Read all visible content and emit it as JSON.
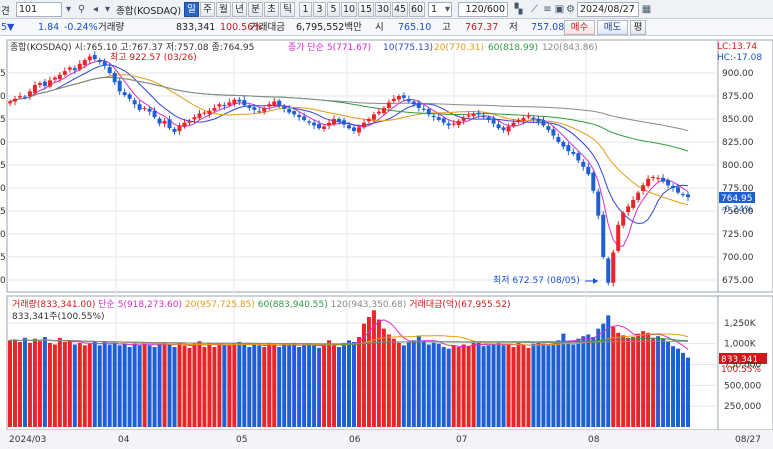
{
  "toolbar": {
    "left_label": "견",
    "code_value": "101",
    "name_value": "종합(KOSDAQ)",
    "periods": [
      "일",
      "주",
      "월",
      "년",
      "분",
      "초",
      "틱"
    ],
    "active_period": "일",
    "intervals": [
      "1",
      "3",
      "5",
      "10",
      "15",
      "30",
      "45",
      "60"
    ],
    "interval_select": "1",
    "count_display": "120/600",
    "date_value": "2024/08/27"
  },
  "quote": {
    "arrow": "5▼",
    "change": "1.84",
    "change_pct": "-0.24%",
    "volume_label": "거래량",
    "volume": "833,341",
    "volume_ratio": "100.56%",
    "amount_label": "거래대금",
    "amount": "6,795,552백만",
    "open_label": "시",
    "open": "765.10",
    "high_label": "고",
    "high": "767.37",
    "low_label": "저",
    "low": "757.08",
    "buy_label": "매수",
    "sell_label": "매도",
    "eval_label": "평"
  },
  "price_panel": {
    "legend_main": "종합(KOSDAQ) 시:765.10 고:767.37 저:757.08 종:764.95",
    "ma_label": "종가 단순",
    "ma5": "5(771.67)",
    "ma10": "10(775.13)",
    "ma20": "20(770.31)",
    "ma60": "60(818.99)",
    "ma120": "120(843.86)",
    "lc": "LC:13.74",
    "hc": "HC:-17.08",
    "max_note": "최고 922.57 (03/26)",
    "min_note": "최저 672.57 (08/05)",
    "current_price": "764.95",
    "current_pct": "-0.24%",
    "yticks": [
      "900.00",
      "875.00",
      "850.00",
      "825.00",
      "800.00",
      "775.00",
      "750.00",
      "725.00",
      "700.00",
      "675.00"
    ],
    "left_edge_ticks": [
      "5",
      "0",
      "5",
      "0",
      "5",
      "0",
      "5",
      "0",
      "5",
      "0"
    ]
  },
  "volume_panel": {
    "legend_vol": "거래량(833,341.00)",
    "ma_label": "단순",
    "ma5": "5(918,273.60)",
    "ma20": "20(957,725.85)",
    "ma60": "60(883,940.55)",
    "ma120": "120(943,350.68)",
    "legend_amt": "거래대금(억)(67,955.52)",
    "note": "833,341주(100.55%)",
    "current_vol": "833,341",
    "current_pct": "100.55%",
    "yticks": [
      "1,250K",
      "1,000K",
      "750,000",
      "500,000",
      "250,000"
    ]
  },
  "xaxis": {
    "labels": [
      "2024/03",
      "04",
      "05",
      "06",
      "07",
      "08"
    ],
    "right_label": "08/27"
  },
  "colors": {
    "up": "#e8262a",
    "down": "#1f5fd6",
    "ma5": "#d82bd0",
    "ma10": "#3246d8",
    "ma20": "#e89a18",
    "ma60": "#2e9c42",
    "ma120": "#8a8a8a"
  },
  "chart_data": {
    "type": "candlestick",
    "close_start": 869,
    "close_series": [
      869,
      872,
      875,
      874,
      880,
      887,
      889,
      886,
      892,
      895,
      898,
      902,
      906,
      903,
      910,
      914,
      918,
      915,
      912,
      908,
      900,
      890,
      880,
      876,
      872,
      866,
      860,
      862,
      858,
      852,
      845,
      848,
      840,
      836,
      843,
      846,
      848,
      852,
      856,
      857,
      859,
      862,
      866,
      864,
      868,
      871,
      869,
      865,
      862,
      860,
      858,
      862,
      866,
      869,
      865,
      861,
      857,
      855,
      852,
      849,
      846,
      843,
      840,
      842,
      846,
      850,
      847,
      844,
      840,
      837,
      841,
      846,
      850,
      855,
      858,
      862,
      868,
      872,
      875,
      873,
      869,
      866,
      862,
      860,
      855,
      852,
      849,
      846,
      843,
      845,
      848,
      851,
      854,
      856,
      855,
      852,
      849,
      845,
      840,
      838,
      842,
      846,
      849,
      851,
      853,
      850,
      847,
      843,
      838,
      832,
      825,
      820,
      815,
      812,
      805,
      798,
      790,
      772,
      745,
      700,
      672,
      705,
      735,
      748,
      755,
      762,
      770,
      778,
      785,
      787,
      786,
      782,
      778,
      775,
      770,
      768,
      765
    ],
    "volume_series": [
      1040,
      1050,
      1020,
      1070,
      1010,
      1060,
      1030,
      1080,
      1010,
      990,
      1070,
      1020,
      1040,
      990,
      1010,
      980,
      1000,
      1030,
      980,
      1020,
      990,
      1010,
      980,
      1000,
      960,
      1000,
      980,
      1010,
      980,
      960,
      1000,
      1020,
      990,
      960,
      1010,
      980,
      950,
      1000,
      1030,
      960,
      1010,
      960,
      1000,
      990,
      980,
      1010,
      1020,
      990,
      960,
      1000,
      980,
      960,
      1010,
      990,
      960,
      1000,
      980,
      1010,
      960,
      990,
      1000,
      980,
      950,
      990,
      1040,
      980,
      960,
      1010,
      1040,
      1020,
      1080,
      1240,
      1320,
      1400,
      1290,
      1180,
      1110,
      1060,
      1010,
      980,
      1020,
      1040,
      1090,
      1040,
      990,
      1010,
      1000,
      960,
      940,
      980,
      960,
      990,
      970,
      1010,
      1010,
      970,
      980,
      990,
      1010,
      980,
      1000,
      960,
      1010,
      990,
      950,
      1000,
      1020,
      1000,
      980,
      990,
      1040,
      1120,
      1030,
      990,
      1060,
      1090,
      1110,
      1080,
      1180,
      1240,
      1340,
      1200,
      1130,
      1100,
      1070,
      1080,
      1120,
      1150,
      1130,
      1070,
      1090,
      1060,
      1020,
      970,
      940,
      890,
      833
    ],
    "ylim_price": [
      660,
      925
    ],
    "ylim_volume": [
      0,
      1500
    ]
  }
}
